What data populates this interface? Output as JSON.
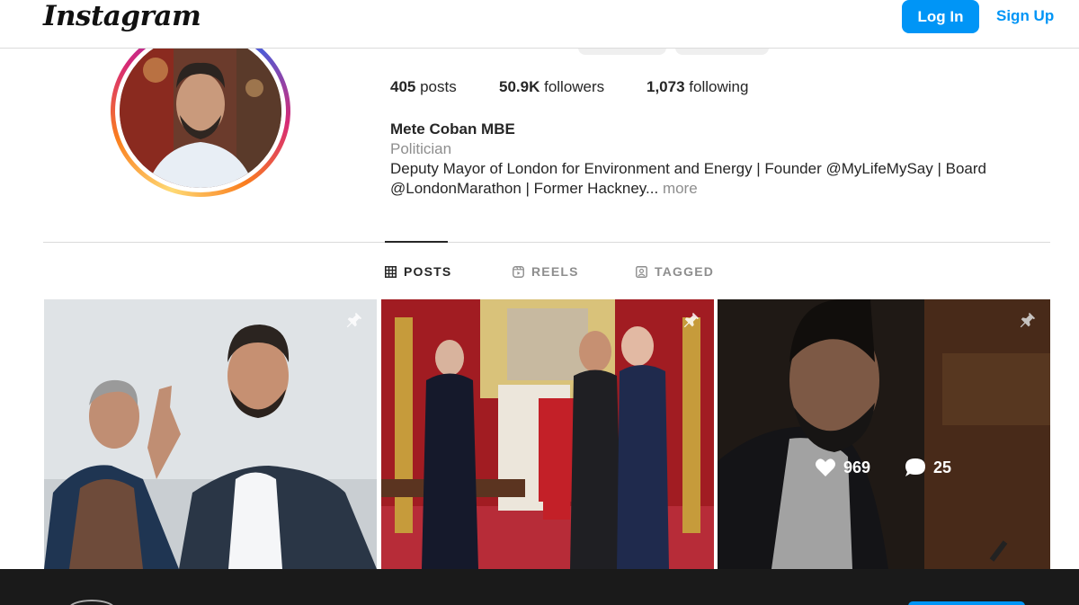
{
  "nav": {
    "logo": "Instagram",
    "login_label": "Log In",
    "signup_label": "Sign Up"
  },
  "profile": {
    "stats": [
      {
        "value": "405",
        "label": " posts"
      },
      {
        "value": "50.9K",
        "label": " followers"
      },
      {
        "value": "1,073",
        "label": " following"
      }
    ],
    "name": "Mete Coban MBE",
    "category": "Politician",
    "bio_line1": "Deputy Mayor of London for Environment and Energy | Founder @MyLifeMySay | Board",
    "bio_line2": "@LondonMarathon | Former Hackney...",
    "more": " more"
  },
  "tabs": [
    {
      "label": "POSTS",
      "icon": "grid-icon",
      "active": true
    },
    {
      "label": "REELS",
      "icon": "reels-icon",
      "active": false
    },
    {
      "label": "TAGGED",
      "icon": "tagged-icon",
      "active": false
    }
  ],
  "posts": [
    {
      "pinned": true,
      "icon": "pin-icon"
    },
    {
      "pinned": true,
      "icon": "pin-icon"
    },
    {
      "pinned": true,
      "icon": "pin-icon",
      "likes": "969",
      "comments": "25"
    }
  ],
  "colors": {
    "accent": "#0095f6",
    "text": "#262626",
    "muted": "#8e8e8e",
    "border": "#dbdbdb"
  }
}
